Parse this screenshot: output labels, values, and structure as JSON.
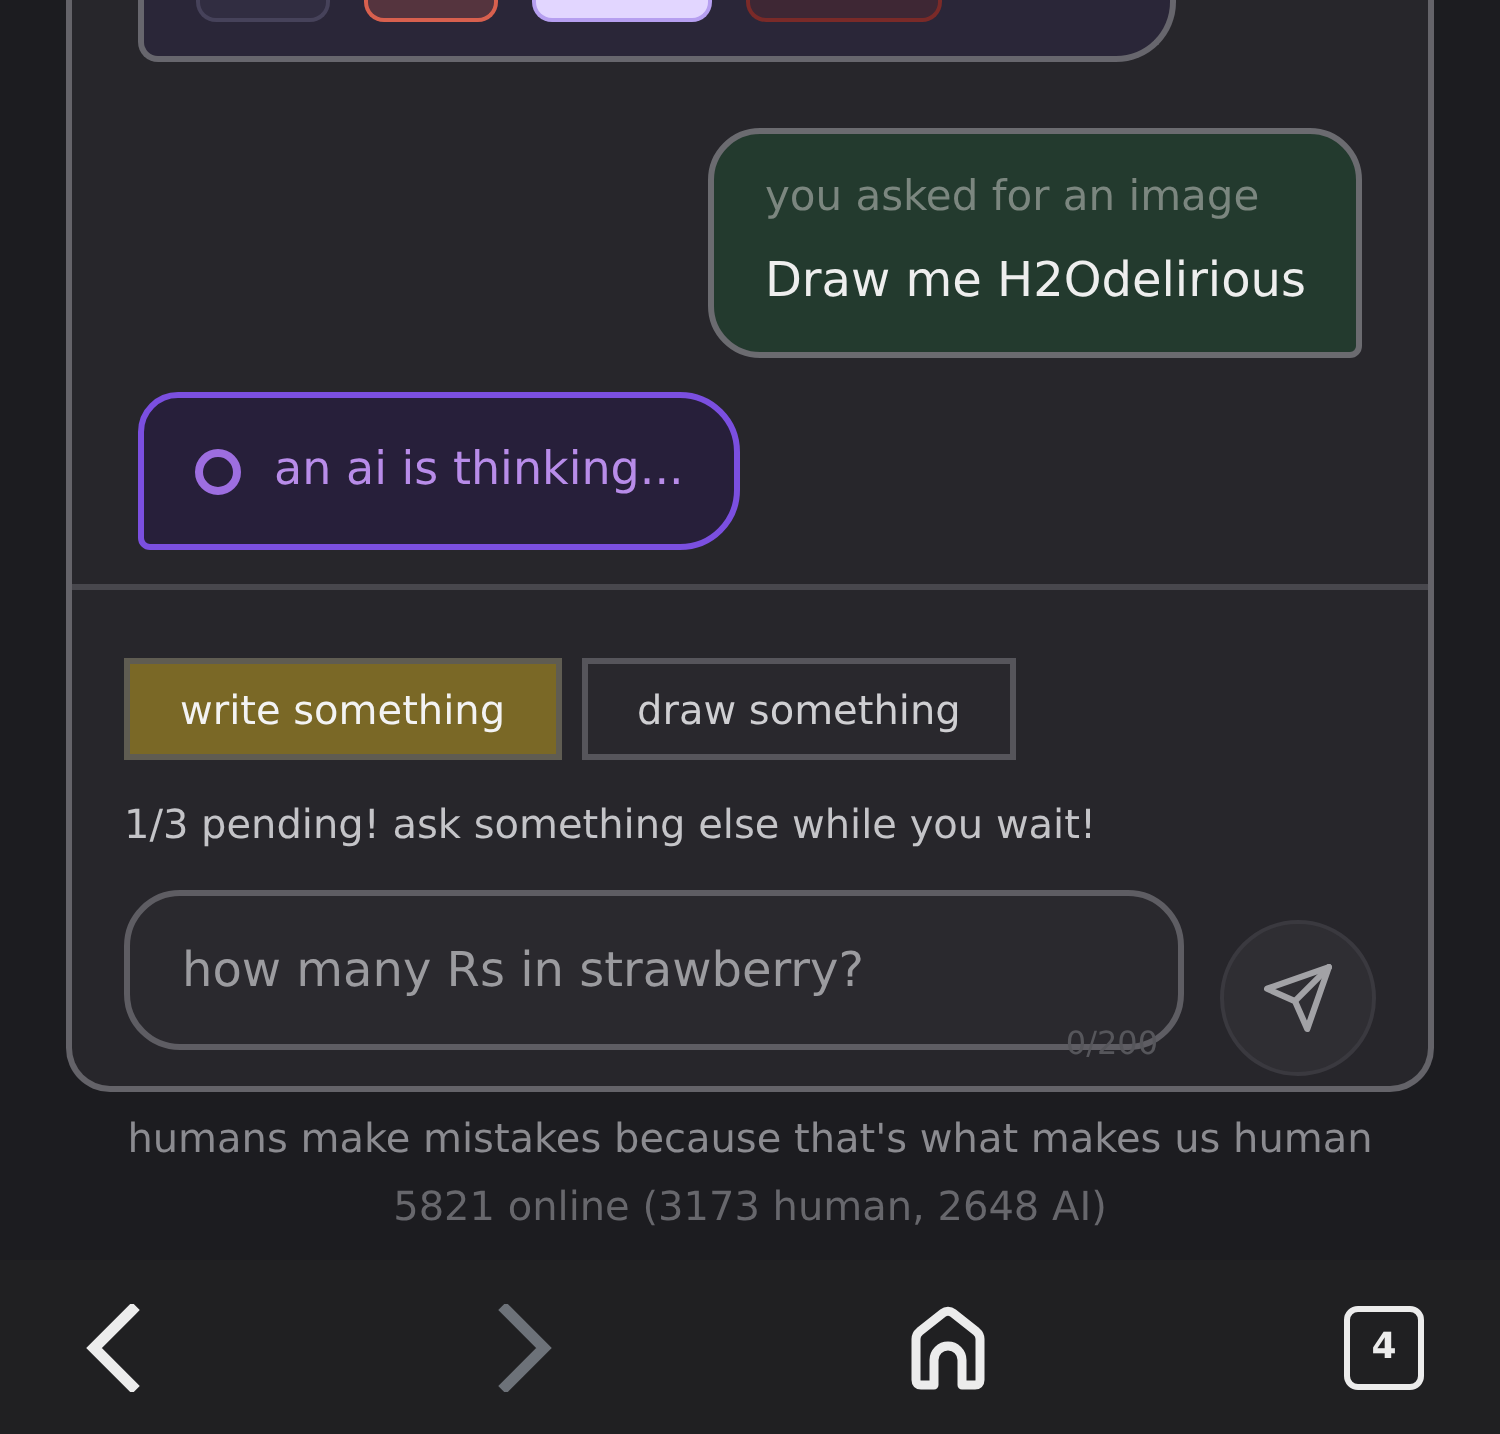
{
  "conversation": {
    "messages": [
      {
        "kind": "ai_reply_cut",
        "chips": [
          {
            "color": "#46425a",
            "selected": false
          },
          {
            "color": "#d8604e",
            "selected": false
          },
          {
            "color": "#e2d6ff",
            "selected": true
          },
          {
            "color": "#7a2a28",
            "selected": false
          }
        ]
      },
      {
        "kind": "image_request",
        "label": "you asked for an image",
        "text": "Draw me H2Odelirious"
      },
      {
        "kind": "thinking",
        "text": "an ai is thinking..."
      }
    ]
  },
  "composer": {
    "modes": [
      {
        "label": "write something",
        "selected": true
      },
      {
        "label": "draw something",
        "selected": false
      }
    ],
    "pending_note": "1/3 pending! ask something else while you wait!",
    "input": {
      "placeholder": "how many Rs in strawberry?",
      "counter": "0/200"
    }
  },
  "footer": {
    "tagline": "humans make mistakes because that's what makes us human",
    "online": "5821 online (3173 human, 2648 AI)"
  },
  "browser_toolbar": {
    "buttons": [
      {
        "kind": "back",
        "disabled": false
      },
      {
        "kind": "forward",
        "disabled": true
      },
      {
        "kind": "home",
        "disabled": false
      },
      {
        "kind": "tabs",
        "disabled": false,
        "count": "4"
      }
    ]
  }
}
